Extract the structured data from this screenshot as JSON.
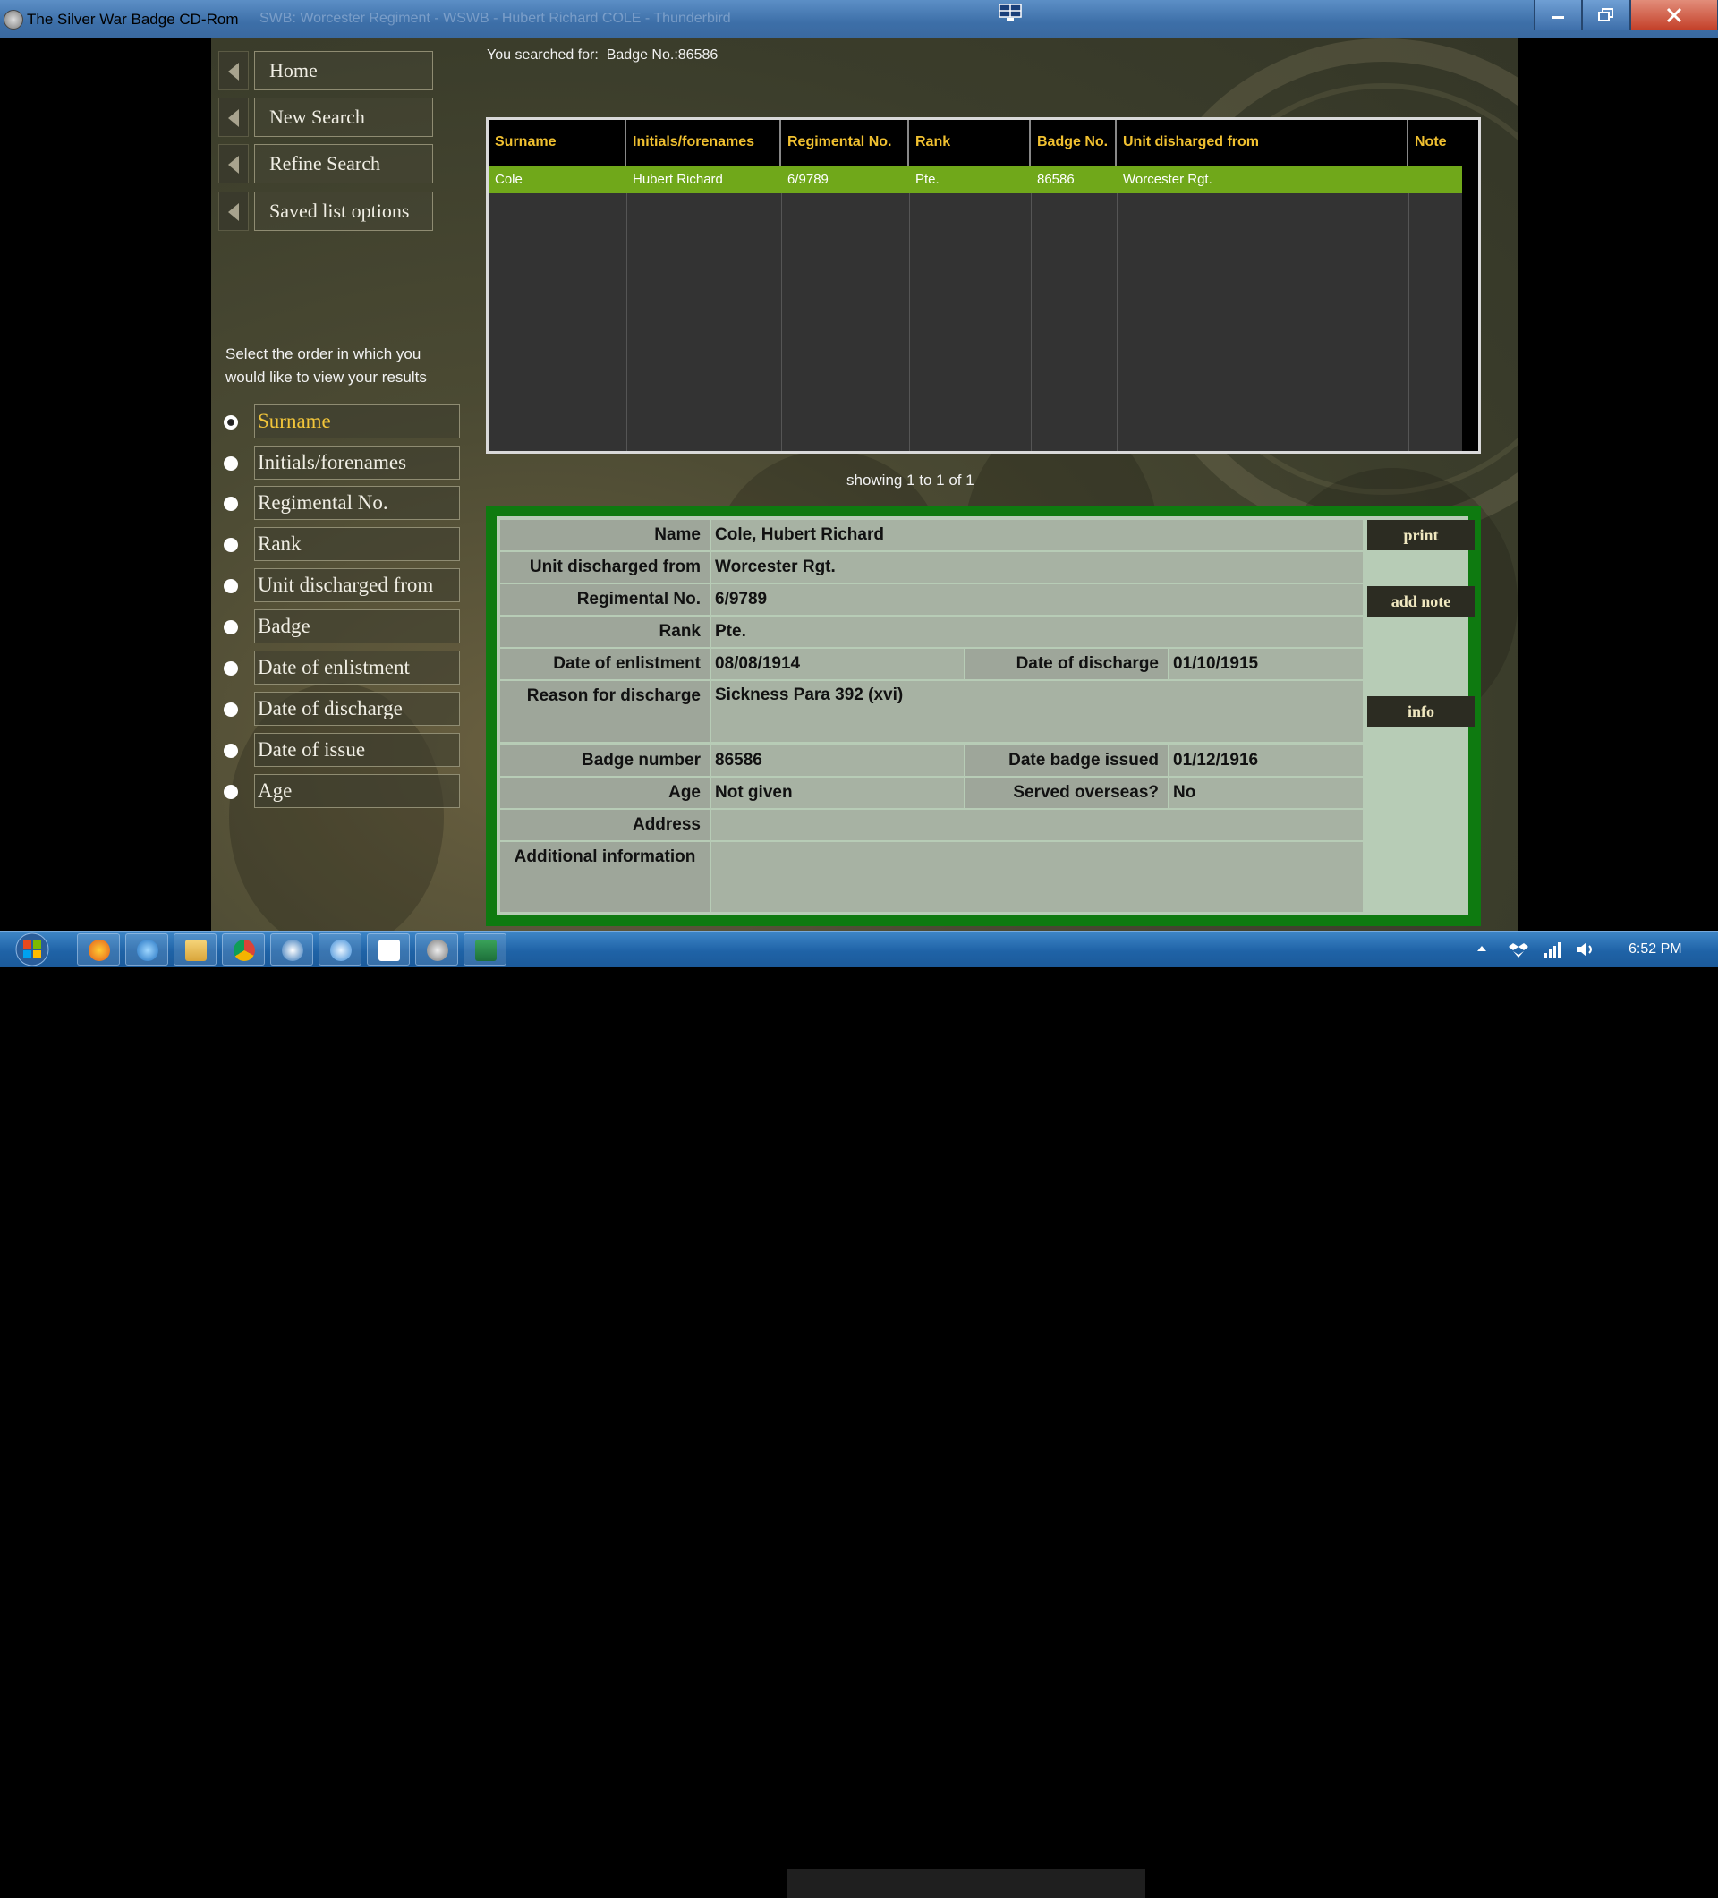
{
  "window": {
    "title": "The Silver War Badge CD-Rom",
    "ghost_title": "SWB: Worcester Regiment - WSWB - Hubert Richard COLE - Thunderbird"
  },
  "nav": [
    {
      "label": "Home"
    },
    {
      "label": "New Search"
    },
    {
      "label": "Refine Search"
    },
    {
      "label": "Saved list options"
    }
  ],
  "sort": {
    "instructions": "Select the order in which you would like to view your results",
    "selected": "Surname",
    "options": [
      "Surname",
      "Initials/forenames",
      "Regimental No.",
      "Rank",
      "Unit discharged from",
      "Badge",
      "Date of enlistment",
      "Date of discharge",
      "Date of issue",
      "Age"
    ]
  },
  "search": {
    "prefix": "You searched for:",
    "query": "Badge No.:86586"
  },
  "results": {
    "headers": [
      "Surname",
      "Initials/forenames",
      "Regimental No.",
      "Rank",
      "Badge No.",
      "Unit disharged from",
      "Note"
    ],
    "rows": [
      [
        "Cole",
        "Hubert Richard",
        "6/9789",
        "Pte.",
        "86586",
        "Worcester Rgt.",
        ""
      ]
    ],
    "showing": "showing 1 to 1 of 1"
  },
  "details": {
    "name_label": "Name",
    "name": "Cole, Hubert Richard",
    "unit_label": "Unit discharged from",
    "unit": "Worcester Rgt.",
    "regno_label": "Regimental No.",
    "regno": "6/9789",
    "rank_label": "Rank",
    "rank": "Pte.",
    "enlist_label": "Date of enlistment",
    "enlist": "08/08/1914",
    "discharge_label": "Date of discharge",
    "discharge": "01/10/1915",
    "reason_label": "Reason for discharge",
    "reason": "Sickness Para 392 (xvi)",
    "badge_label": "Badge number",
    "badge": "86586",
    "issued_label": "Date badge issued",
    "issued": "01/12/1916",
    "age_label": "Age",
    "age": "Not given",
    "overseas_label": "Served overseas?",
    "overseas": "No",
    "address_label": "Address",
    "address": "",
    "additional_label": "Additional information",
    "additional": "",
    "print_label": "print",
    "add_note_label": "add note",
    "info_label": "info"
  },
  "taskbar": {
    "clock": "6:52 PM",
    "apps": [
      "firefox-icon",
      "ie-icon",
      "explorer-icon",
      "chrome-icon",
      "thunderbird-icon",
      "media-icon",
      "dropbox-icon",
      "swb-icon",
      "excel-icon"
    ]
  },
  "colors": {
    "accent_gold": "#f0c030",
    "selected_row": "#70a81a",
    "details_border": "#0e7a10"
  }
}
